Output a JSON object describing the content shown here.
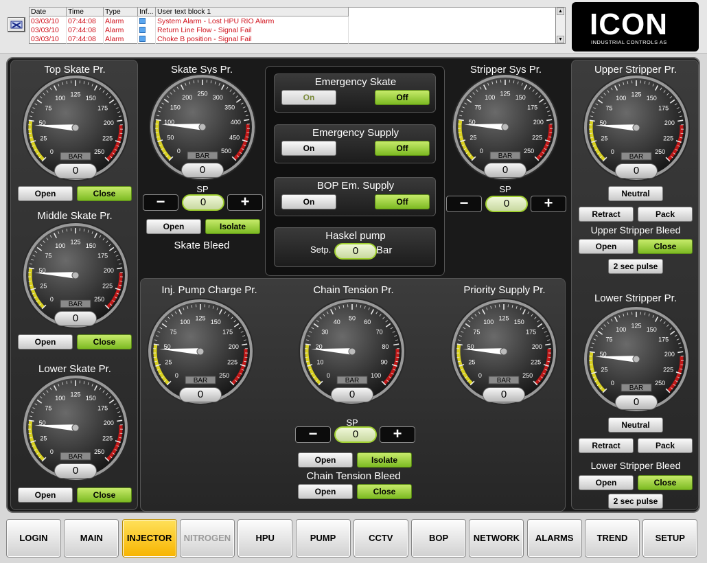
{
  "alarms": {
    "headers": [
      "Date",
      "Time",
      "Type",
      "Inf...",
      "User text block 1"
    ],
    "rows": [
      {
        "date": "03/03/10",
        "time": "07:44:08",
        "type": "Alarm",
        "text": "System Alarm - Lost HPU RIO Alarm"
      },
      {
        "date": "03/03/10",
        "time": "07:44:08",
        "type": "Alarm",
        "text": "Return Line Flow - Signal Fail"
      },
      {
        "date": "03/03/10",
        "time": "07:44:08",
        "type": "Alarm",
        "text": "Choke B position - Signal Fail"
      }
    ]
  },
  "logo": {
    "name": "ICON",
    "sub": "INDUSTRIAL CONTROLS AS"
  },
  "unit": "BAR",
  "sp": "SP",
  "panels": {
    "top_skate": {
      "title": "Top Skate Pr.",
      "value": "0",
      "open": "Open",
      "close": "Close"
    },
    "middle_skate": {
      "title": "Middle Skate Pr.",
      "value": "0",
      "open": "Open",
      "close": "Close"
    },
    "lower_skate": {
      "title": "Lower Skate Pr.",
      "value": "0",
      "open": "Open",
      "close": "Close"
    },
    "skate_sys": {
      "title": "Skate Sys Pr.",
      "value": "0",
      "sp_value": "0",
      "open": "Open",
      "isolate": "Isolate",
      "bleed": "Skate Bleed"
    },
    "stripper_sys": {
      "title": "Stripper Sys Pr.",
      "value": "0",
      "sp_value": "0"
    },
    "upper_stripper": {
      "title": "Upper Stripper Pr.",
      "value": "0",
      "neutral": "Neutral",
      "retract": "Retract",
      "pack": "Pack",
      "bleed": "Upper Stripper Bleed",
      "open": "Open",
      "close": "Close",
      "pulse": "2 sec pulse"
    },
    "lower_stripper": {
      "title": "Lower Stripper Pr.",
      "value": "0",
      "neutral": "Neutral",
      "retract": "Retract",
      "pack": "Pack",
      "bleed": "Lower Stripper Bleed",
      "open": "Open",
      "close": "Close",
      "pulse": "2 sec pulse"
    },
    "inj_pump": {
      "title": "Inj. Pump Charge Pr.",
      "value": "0"
    },
    "chain_tension": {
      "title": "Chain Tension Pr.",
      "value": "0",
      "sp_value": "0",
      "open": "Open",
      "isolate": "Isolate",
      "bleed": "Chain Tension Bleed",
      "bleed_open": "Open",
      "bleed_close": "Close"
    },
    "priority_supply": {
      "title": "Priority Supply Pr.",
      "value": "0"
    }
  },
  "controls": {
    "emergency_skate": {
      "title": "Emergency Skate",
      "on": "On",
      "off": "Off"
    },
    "emergency_supply": {
      "title": "Emergency Supply",
      "on": "On",
      "off": "Off"
    },
    "bop_supply": {
      "title": "BOP Em. Supply",
      "on": "On",
      "off": "Off"
    },
    "haskel": {
      "title": "Haskel pump",
      "setp": "Setp.",
      "value": "0",
      "unit": "Bar"
    }
  },
  "gauge_scales": {
    "p250": [
      "0",
      "25",
      "50",
      "75",
      "100",
      "125",
      "150",
      "175",
      "200",
      "225",
      "250"
    ],
    "p500": [
      "0",
      "50",
      "100",
      "150",
      "200",
      "250",
      "300",
      "350",
      "400",
      "450",
      "500"
    ],
    "p100": [
      "0",
      "10",
      "20",
      "30",
      "40",
      "50",
      "60",
      "70",
      "80",
      "90",
      "100"
    ]
  },
  "nav": [
    "LOGIN",
    "MAIN",
    "INJECTOR",
    "NITROGEN",
    "HPU",
    "PUMP",
    "CCTV",
    "BOP",
    "NETWORK",
    "ALARMS",
    "TREND",
    "SETUP"
  ],
  "nav_active": "INJECTOR",
  "nav_disabled": "NITROGEN",
  "colors": {
    "green": "#8cc63f",
    "yellow": "#f7b400",
    "alarm_red": "#d0101a",
    "zone_yellow": "#d8d020",
    "zone_red": "#c01818"
  }
}
